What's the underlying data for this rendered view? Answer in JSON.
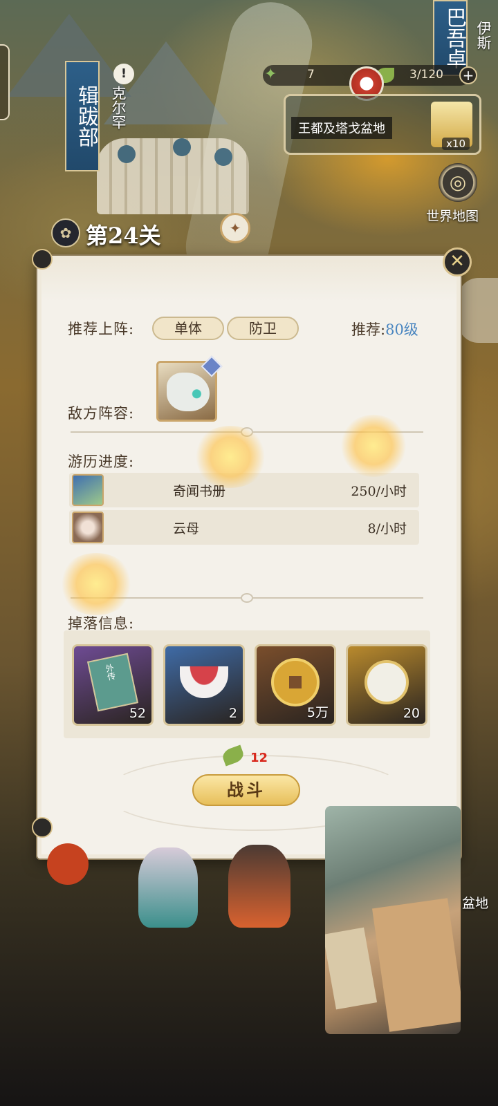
{
  "map": {
    "banners": [
      {
        "text": "巴吾卓"
      },
      {
        "text": "辑跋部"
      }
    ],
    "region_labels": [
      "克尔罕",
      "伊斯"
    ],
    "pin_glyph": "!",
    "resources": {
      "stamina_value": "7",
      "leaf_value": "3/120",
      "plus_label": "+"
    },
    "region_card": {
      "name": "王都及塔戈盆地",
      "reward_count": "x10"
    },
    "world_map_label": "世界地图",
    "bottom_right_label": "盆地"
  },
  "stage": {
    "title": "第24关"
  },
  "panel": {
    "close_icon": "close-icon",
    "recommend_lineup_label": "推荐上阵:",
    "lineup_tags": [
      "单体",
      "防卫"
    ],
    "recommend_level_label": "推荐:",
    "recommend_level_value": "80级",
    "enemy_label": "敌方阵容:",
    "progress_label": "游历进度:",
    "progress_rows": [
      {
        "name": "奇闻书册",
        "rate": "250/小时"
      },
      {
        "name": "云母",
        "rate": "8/小时"
      }
    ],
    "drops_label": "掉落信息:",
    "drops": [
      {
        "count": "52",
        "bg": "#6e4b93"
      },
      {
        "count": "2",
        "bg": "#3f6ba6"
      },
      {
        "count": "5万",
        "bg": "#7a4e2c"
      },
      {
        "count": "20",
        "bg": "#b98a2d"
      }
    ],
    "drop_item_label": "外传",
    "cost": "12",
    "fight_button": "战斗"
  },
  "colors": {
    "accent_gold": "#e7bf5a",
    "level_blue": "#4a86c0",
    "cost_red": "#d8281d"
  }
}
